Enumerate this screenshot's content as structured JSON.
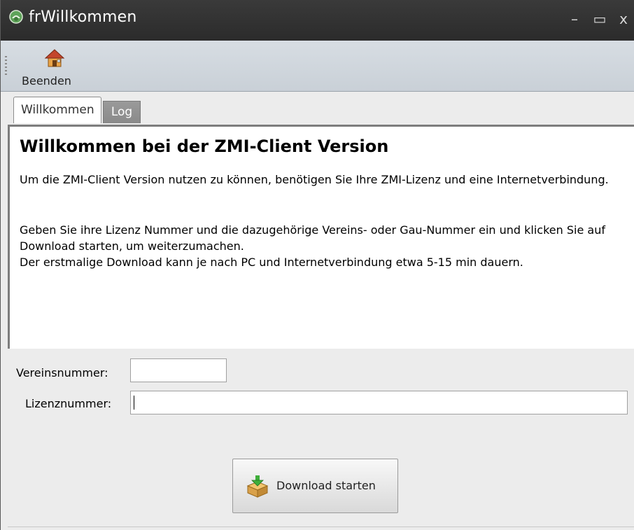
{
  "window": {
    "title": "frWillkommen",
    "minimize_glyph": "–",
    "maximize_glyph": "▭",
    "close_glyph": "x"
  },
  "toolbar": {
    "beenden_label": "Beenden"
  },
  "tabs": [
    {
      "label": "Willkommen",
      "active": true
    },
    {
      "label": "Log",
      "active": false
    }
  ],
  "welcome": {
    "heading": "Willkommen bei der ZMI-Client Version",
    "paragraph1": "Um die ZMI-Client Version nutzen zu können, benötigen Sie Ihre ZMI-Lizenz und eine Internetverbindung.",
    "paragraph2_line1": "Geben Sie ihre Lizenz Nummer und die dazugehörige Vereins- oder Gau-Nummer ein und klicken Sie auf Download starten, um weiterzumachen.",
    "paragraph2_line2": "Der erstmalige Download kann je nach PC und Internetverbindung etwa 5-15 min dauern."
  },
  "form": {
    "vereinsnummer_label": "Vereinsnummer:",
    "vereinsnummer_value": "",
    "lizenznummer_label": "Lizenznummer:",
    "lizenznummer_value": ""
  },
  "download_button": {
    "label": "Download starten"
  },
  "colors": {
    "titlebar": "#2f2f2f",
    "toolbar": "#cfd6dd",
    "tab_log": "#8f8f8f"
  }
}
